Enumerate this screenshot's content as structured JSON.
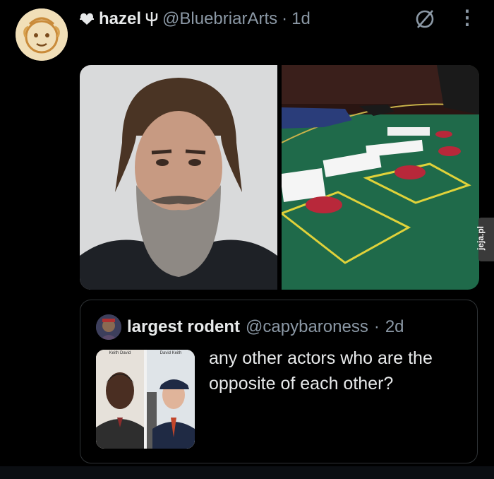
{
  "post": {
    "display_name": "hazel",
    "handle": "@BluebriarArts",
    "separator": "·",
    "time": "1d",
    "icons": {
      "pre_name": "heart-arrow-icon",
      "post_name": "psi-symbol-icon",
      "grok": "grok-icon",
      "more": "more-dots-icon"
    },
    "more_label": "⋮"
  },
  "watermark": {
    "text": "jeja.pl"
  },
  "quote": {
    "display_name": "largest rodent",
    "handle": "@capybaroness",
    "separator": "·",
    "time": "2d",
    "text": "any other actors who are the opposite of each other?",
    "image_captions": [
      "Keith David",
      "David Keith"
    ]
  }
}
